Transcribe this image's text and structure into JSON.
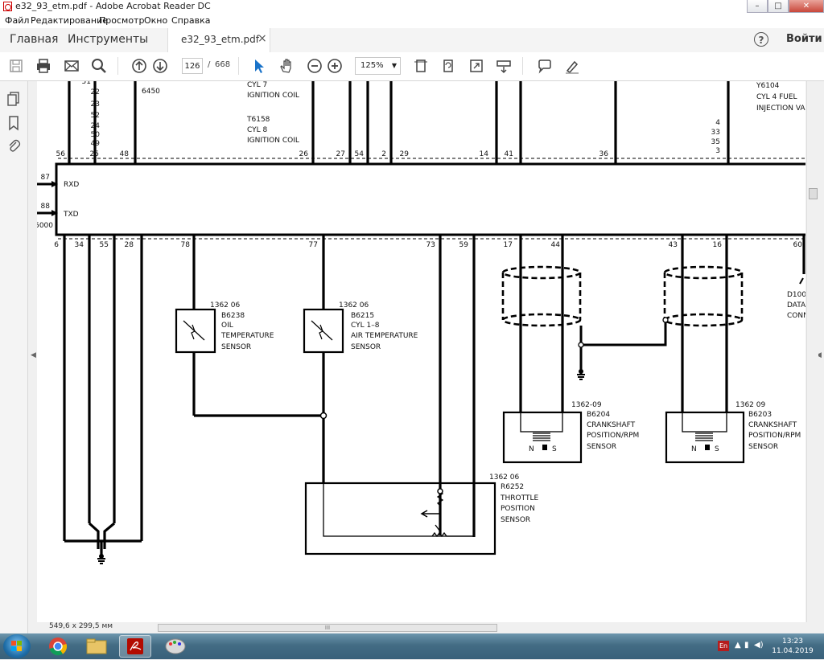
{
  "window": {
    "title": "e32_93_etm.pdf - Adobe Acrobat Reader DC",
    "minimize": "–",
    "maximize": "□",
    "close": "✕"
  },
  "menu": [
    "Файл",
    "Редактирование",
    "Просмотр",
    "Окно",
    "Справка"
  ],
  "tabs": {
    "home": "Главная",
    "tools": "Инструменты",
    "document": "e32_93_etm.pdf",
    "close": "×"
  },
  "header": {
    "help": "?",
    "login": "Войти"
  },
  "toolbar": {
    "page_current": "126",
    "page_separator": "/",
    "page_total": "668",
    "zoom": "125%"
  },
  "status": {
    "page_size": "549,6 x 299,5 мм",
    "scroll_grip": "III"
  },
  "taskbar": {
    "time": "13:23",
    "date": "11.04.2019",
    "lang": "En"
  },
  "diagram": {
    "top_pins_left_column": [
      "51",
      "22",
      "23",
      "52",
      "24",
      "50",
      "49"
    ],
    "top_connectors": [
      "56",
      "25",
      "48",
      "26",
      "27",
      "54",
      "2",
      "29",
      "14",
      "41",
      "36"
    ],
    "top_pins_right_column": [
      "4",
      "33",
      "35",
      "3"
    ],
    "left_pins": [
      "87",
      "88",
      "5000"
    ],
    "bottom_connectors": [
      "6",
      "34",
      "55",
      "28",
      "78",
      "77",
      "73",
      "59",
      "17",
      "44",
      "43",
      "16",
      "60"
    ],
    "module_signals": {
      "rxd": "RXD",
      "txd": "TXD"
    },
    "labels": {
      "code_6450": "6450",
      "cyl7_1": "CYL 7",
      "cyl7_2": "IGNITION COIL",
      "cyl8_0": "T6158",
      "cyl8_1": "CYL 8",
      "cyl8_2": "IGNITION COIL",
      "inj_0": "Y6104",
      "inj_1": "CYL 4 FUEL",
      "inj_2": "INJECTION VA",
      "oil_0": "1362 06",
      "oil_1": "B6238",
      "oil_2": "OIL",
      "oil_3": "TEMPERATURE",
      "oil_4": "SENSOR",
      "air_0": "1362 06",
      "air_1": "B6215",
      "air_2": "CYL 1–8",
      "air_3": "AIR TEMPERATURE",
      "air_4": "SENSOR",
      "tps_0": "1362 06",
      "tps_1": "R6252",
      "tps_2": "THROTTLE",
      "tps_3": "POSITION",
      "tps_4": "SENSOR",
      "crank1_0": "1362-09",
      "crank1_1": "B6204",
      "crank1_2": "CRANKSHAFT",
      "crank1_3": "POSITION/RPM",
      "crank1_4": "SENSOR",
      "crank2_0": "1362 09",
      "crank2_1": "B6203",
      "crank2_2": "CRANKSHAFT",
      "crank2_3": "POSITION/RPM",
      "crank2_4": "SENSOR",
      "d100_0": "D100",
      "d100_1": "DATA",
      "d100_2": "CONN",
      "ns_1": "N",
      "ns_2": "S"
    }
  }
}
